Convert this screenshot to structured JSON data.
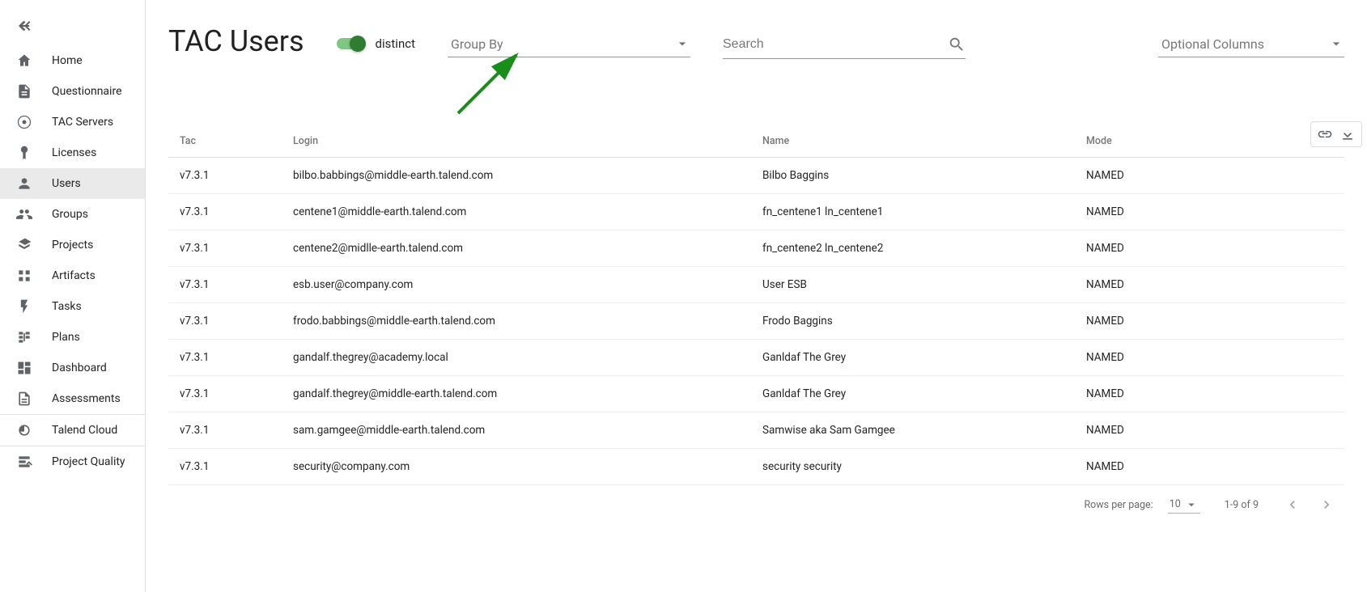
{
  "sidebar": {
    "items": [
      {
        "icon": "home",
        "label": "Home"
      },
      {
        "icon": "questionnaire",
        "label": "Questionnaire"
      },
      {
        "icon": "server",
        "label": "TAC Servers"
      },
      {
        "icon": "license",
        "label": "Licenses"
      },
      {
        "icon": "user",
        "label": "Users",
        "active": true
      },
      {
        "icon": "groups",
        "label": "Groups"
      },
      {
        "icon": "projects",
        "label": "Projects"
      },
      {
        "icon": "artifacts",
        "label": "Artifacts"
      },
      {
        "icon": "tasks",
        "label": "Tasks"
      },
      {
        "icon": "plans",
        "label": "Plans"
      },
      {
        "icon": "dashboard",
        "label": "Dashboard"
      },
      {
        "icon": "assess",
        "label": "Assessments"
      },
      {
        "icon": "cloud",
        "label": "Talend Cloud"
      },
      {
        "icon": "quality",
        "label": "Project Quality"
      }
    ]
  },
  "header": {
    "title": "TAC Users",
    "distinct_toggle_label": "distinct",
    "group_by_placeholder": "Group By",
    "search_placeholder": "Search",
    "optional_cols_placeholder": "Optional Columns"
  },
  "table": {
    "columns": {
      "tac": "Tac",
      "login": "Login",
      "name": "Name",
      "mode": "Mode"
    },
    "rows": [
      {
        "tac": "v7.3.1",
        "login": "bilbo.babbings@middle-earth.talend.com",
        "name": "Bilbo Baggins",
        "mode": "NAMED"
      },
      {
        "tac": "v7.3.1",
        "login": "centene1@middle-earth.talend.com",
        "name": "fn_centene1 ln_centene1",
        "mode": "NAMED"
      },
      {
        "tac": "v7.3.1",
        "login": "centene2@midlle-earth.talend.com",
        "name": "fn_centene2 ln_centene2",
        "mode": "NAMED"
      },
      {
        "tac": "v7.3.1",
        "login": "esb.user@company.com",
        "name": "User ESB",
        "mode": "NAMED"
      },
      {
        "tac": "v7.3.1",
        "login": "frodo.babbings@middle-earth.talend.com",
        "name": "Frodo Baggins",
        "mode": "NAMED"
      },
      {
        "tac": "v7.3.1",
        "login": "gandalf.thegrey@academy.local",
        "name": "Ganldaf The Grey",
        "mode": "NAMED"
      },
      {
        "tac": "v7.3.1",
        "login": "gandalf.thegrey@middle-earth.talend.com",
        "name": "Ganldaf The Grey",
        "mode": "NAMED"
      },
      {
        "tac": "v7.3.1",
        "login": "sam.gamgee@middle-earth.talend.com",
        "name": "Samwise aka Sam Gamgee",
        "mode": "NAMED"
      },
      {
        "tac": "v7.3.1",
        "login": "security@company.com",
        "name": "security security",
        "mode": "NAMED"
      }
    ]
  },
  "pager": {
    "rows_per_page_label": "Rows per page:",
    "rows_per_page_value": "10",
    "range": "1-9 of 9"
  }
}
